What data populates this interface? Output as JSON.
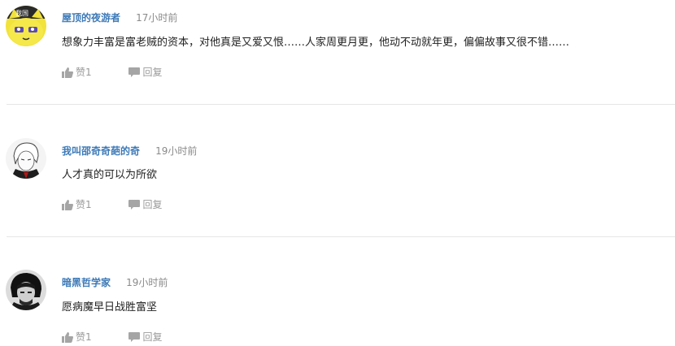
{
  "comments": [
    {
      "username": "屋顶的夜游者",
      "time": "17小时前",
      "text": "想象力丰富是富老贼的资本，对他真是又爱又恨……人家周更月更，他动不动就年更，偏偏故事又很不错……",
      "like_label": "赞1",
      "reply_label": "回复",
      "avatar": "cartoon-cat"
    },
    {
      "username": "我叫邵奇奇葩的奇",
      "time": "19小时前",
      "text": "人才真的可以为所欲",
      "like_label": "赞1",
      "reply_label": "回复",
      "avatar": "anime-sketch"
    },
    {
      "username": "暗黑哲学家",
      "time": "19小时前",
      "text": "愿病魔早日战胜富坚",
      "like_label": "赞1",
      "reply_label": "回复",
      "avatar": "bw-portrait"
    }
  ],
  "colors": {
    "username": "#3d7ab8",
    "time": "#8a8a8a",
    "action": "#9a9a9a",
    "divider": "#e6e6e6"
  },
  "icons": {
    "like": "thumbs-up-icon",
    "reply": "speech-bubble-icon"
  }
}
